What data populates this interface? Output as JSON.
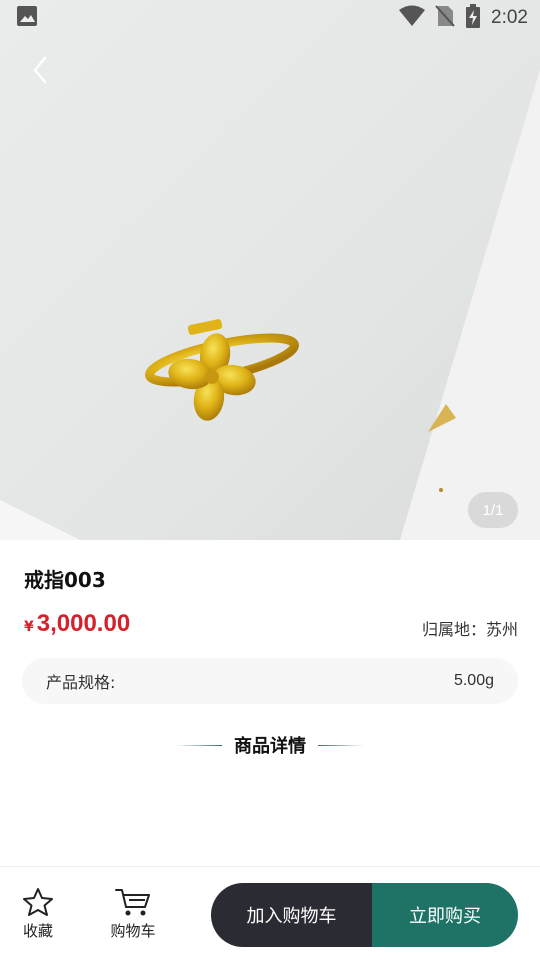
{
  "status_bar": {
    "time": "2:02",
    "icons": [
      "image-notification-icon",
      "wifi-icon",
      "no-sim-icon",
      "battery-charging-icon"
    ]
  },
  "gallery": {
    "image": "gold-clover-ring-photo",
    "pager": "1/1"
  },
  "product": {
    "title": "戒指003",
    "currency": "¥",
    "price": "3,000.00",
    "origin": "归属地：苏州",
    "spec_label": "产品规格:",
    "spec_value": "5.00g"
  },
  "details": {
    "heading": "商品详情"
  },
  "bottom_bar": {
    "favorite_label": "收藏",
    "cart_label": "购物车",
    "add_to_cart": "加入购物车",
    "buy_now": "立即购买"
  },
  "colors": {
    "price": "#d3222b",
    "add_to_cart_bg": "#2b2b33",
    "buy_now_bg": "#1f7366"
  }
}
